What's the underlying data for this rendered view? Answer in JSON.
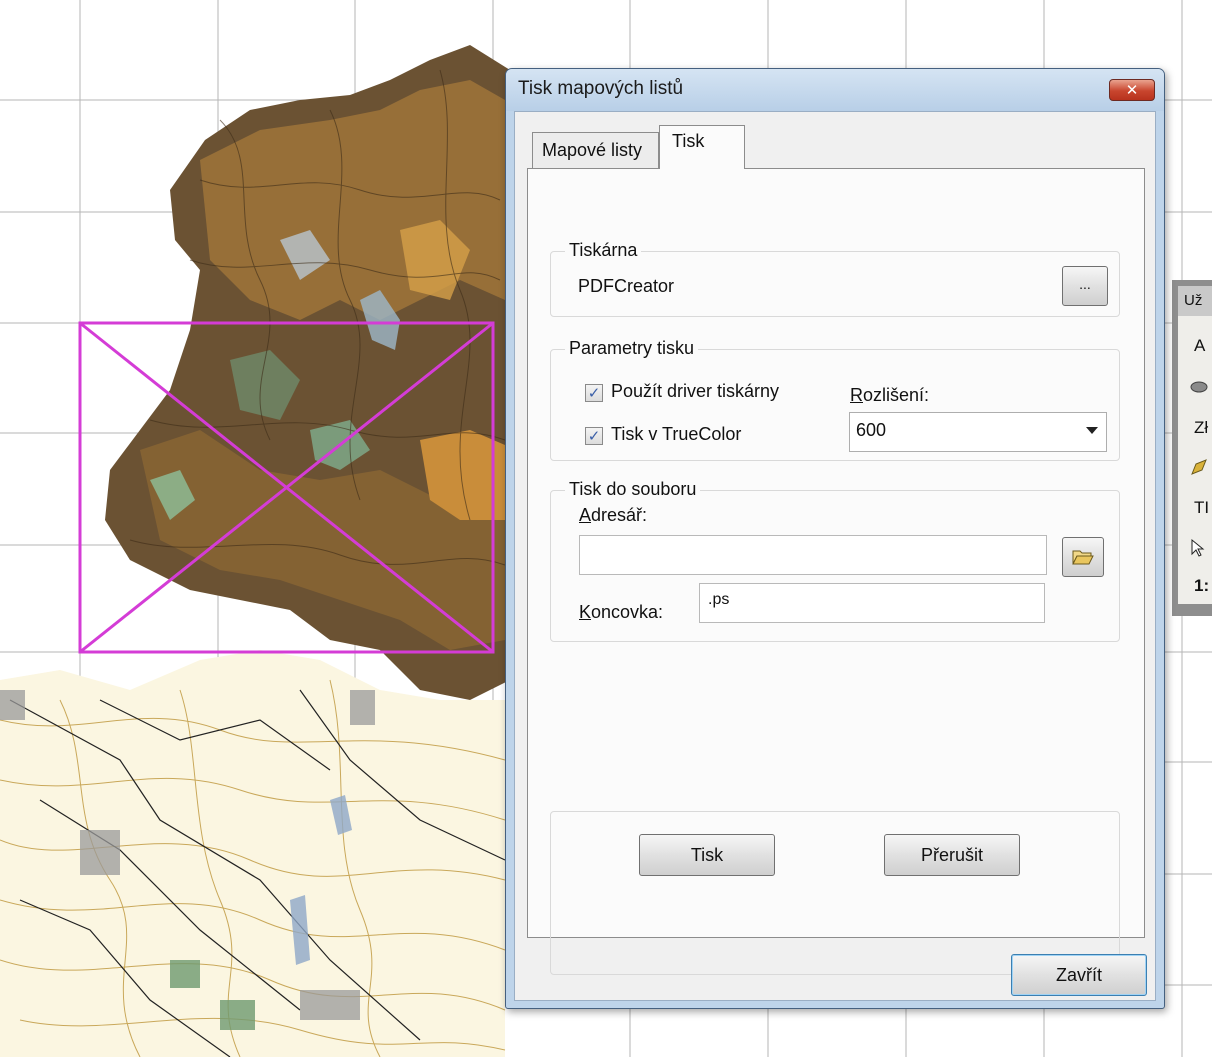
{
  "dialog": {
    "title": "Tisk mapových listů",
    "close_label": "✕",
    "tabs": [
      {
        "label": "Mapové listy",
        "active": false
      },
      {
        "label": "Tisk",
        "active": true
      }
    ],
    "printer_group": {
      "label": "Tiskárna",
      "printer_name": "PDFCreator",
      "browse_label": "..."
    },
    "params_group": {
      "label": "Parametry tisku",
      "use_driver_label": "Použít driver tiskárny",
      "use_driver_checked": true,
      "truecolor_label": "Tisk v TrueColor",
      "truecolor_checked": true,
      "resolution_label_underlined": "R",
      "resolution_label_rest": "ozlišení:",
      "resolution_value": "600"
    },
    "file_group": {
      "label": "Tisk do souboru",
      "directory_label_underlined": "A",
      "directory_label_rest": "dresář:",
      "directory_value": "",
      "extension_label_underlined": "K",
      "extension_label_rest": "oncovka:",
      "extension_value": ".ps"
    },
    "buttons": {
      "print_label": "Tisk",
      "abort_label": "Přerušit",
      "close_label": "Zavřít"
    }
  },
  "side_panel": {
    "header": "Už",
    "rows": [
      "A",
      "",
      "Zł",
      "",
      "TI",
      "",
      "1:"
    ]
  },
  "colors": {
    "dialog_frame": "#bed4ea",
    "overlay_magenta": "#d43cd6",
    "map_brown": "#a87a3a"
  }
}
